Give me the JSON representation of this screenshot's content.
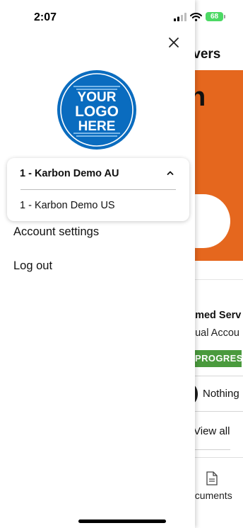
{
  "status_bar": {
    "time": "2:07",
    "battery": "68"
  },
  "background_page": {
    "header_title": "lvers",
    "hero_glyph": "n",
    "card_title": "amed Serv",
    "card_subtitle": "nual Accou",
    "status_badge": "PROGRESS",
    "nothing_text": "Nothing",
    "view_all": "View all",
    "tab_documents": "ocuments"
  },
  "drawer": {
    "logo": {
      "line1": "YOUR",
      "line2": "LOGO",
      "line3": "HERE"
    },
    "org_switcher": {
      "current": "1 - Karbon Demo AU",
      "options": [
        "1 - Karbon Demo US"
      ]
    },
    "menu": {
      "account_settings": "Account settings",
      "log_out": "Log out"
    }
  },
  "colors": {
    "accent_orange": "#e5671e",
    "badge_green": "#4a9a3d",
    "logo_blue": "#0a6cbf",
    "battery_green": "#4cd964"
  }
}
